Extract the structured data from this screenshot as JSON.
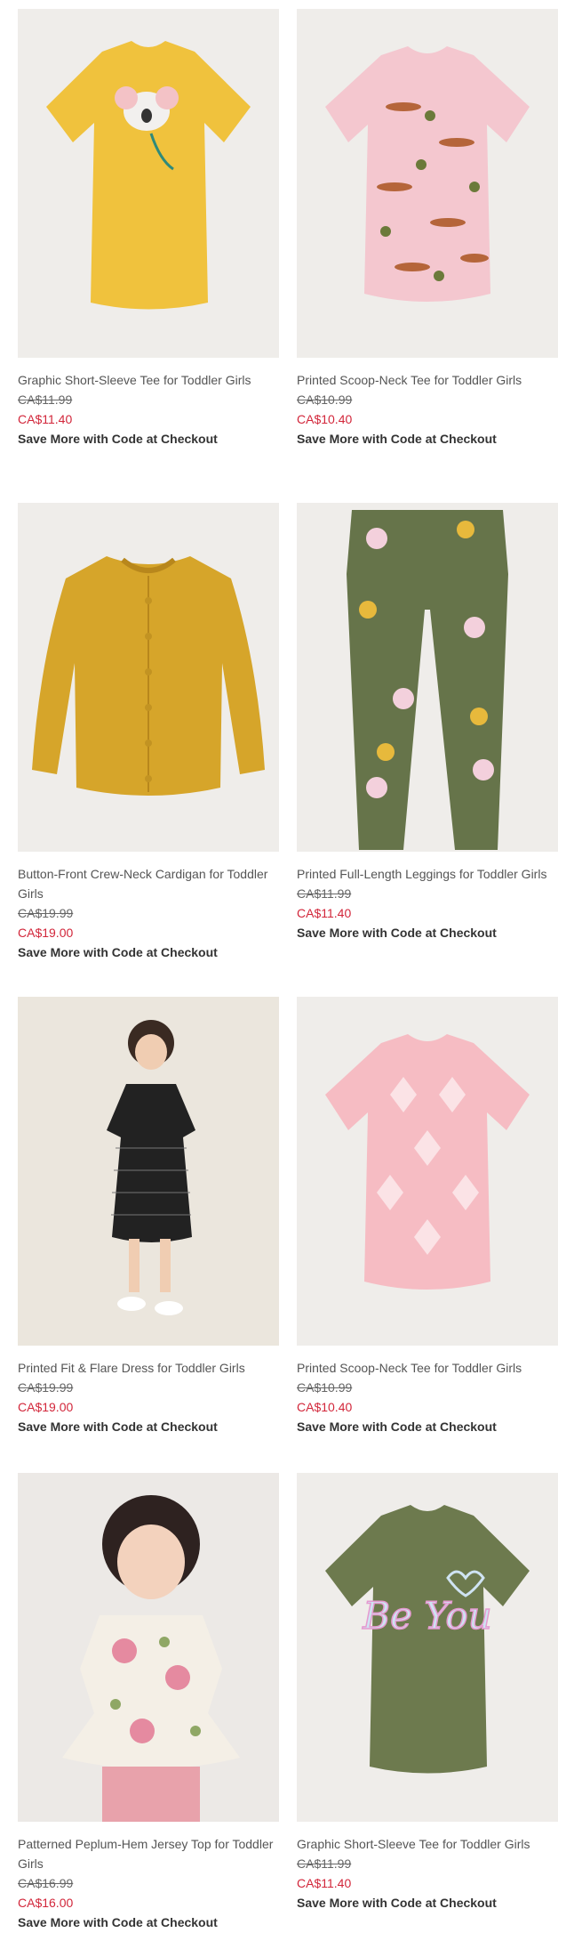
{
  "products": [
    {
      "name": "Graphic Short-Sleeve Tee for Toddler Girls",
      "was": "CA$11.99",
      "now": "CA$11.40",
      "promo": "Save More with Code at Checkout",
      "image": "yellow-koala-tee"
    },
    {
      "name": "Printed Scoop-Neck Tee for Toddler Girls",
      "was": "CA$10.99",
      "now": "CA$10.40",
      "promo": "Save More with Code at Checkout",
      "image": "pink-leopard-tee"
    },
    {
      "name": "Button-Front Crew-Neck Cardigan for Toddler Girls",
      "was": "CA$19.99",
      "now": "CA$19.00",
      "promo": "Save More with Code at Checkout",
      "image": "mustard-cardigan"
    },
    {
      "name": "Printed Full-Length Leggings for Toddler Girls",
      "was": "CA$11.99",
      "now": "CA$11.40",
      "promo": "Save More with Code at Checkout",
      "image": "olive-floral-leggings"
    },
    {
      "name": "Printed Fit & Flare Dress for Toddler Girls",
      "was": "CA$19.99",
      "now": "CA$19.00",
      "promo": "Save More with Code at Checkout",
      "image": "black-striped-dress"
    },
    {
      "name": "Printed Scoop-Neck Tee for Toddler Girls",
      "was": "CA$10.99",
      "now": "CA$10.40",
      "promo": "Save More with Code at Checkout",
      "image": "pink-ikat-tee"
    },
    {
      "name": "Patterned Peplum-Hem Jersey Top for Toddler Girls",
      "was": "CA$16.99",
      "now": "CA$16.00",
      "promo": "Save More with Code at Checkout",
      "image": "floral-peplum-top"
    },
    {
      "name": "Graphic Short-Sleeve Tee for Toddler Girls",
      "was": "CA$11.99",
      "now": "CA$11.40",
      "promo": "Save More with Code at Checkout",
      "image": "olive-be-you-tee"
    }
  ],
  "graphics": {
    "be_you_text": "Be You"
  },
  "colors": {
    "sale": "#d2263a",
    "image_bg": "#efedea"
  }
}
